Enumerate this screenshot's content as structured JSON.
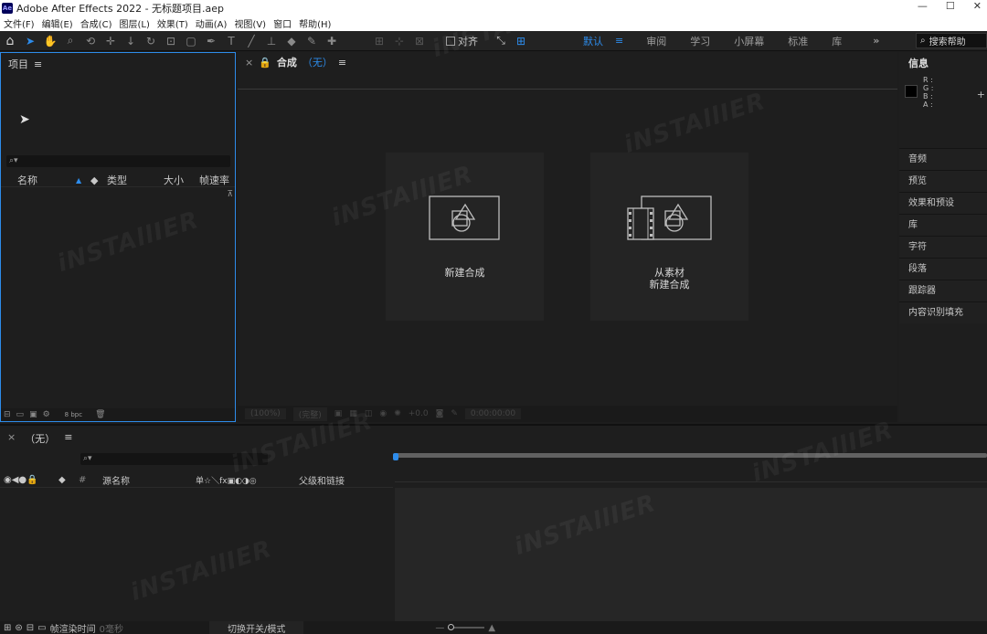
{
  "window": {
    "title": "Adobe After Effects 2022 - 无标题项目.aep",
    "logo": "Ae",
    "controls": [
      "—",
      "☐",
      "✕"
    ]
  },
  "menu": [
    "文件(F)",
    "编辑(E)",
    "合成(C)",
    "图层(L)",
    "效果(T)",
    "动画(A)",
    "视图(V)",
    "窗口",
    "帮助(H)"
  ],
  "toolbar": {
    "align_label": "对齐",
    "workspaces": [
      "默认",
      "审阅",
      "学习",
      "小屏幕",
      "标准",
      "库"
    ],
    "active_workspace": "默认",
    "overflow": "»",
    "search_help": "搜索帮助"
  },
  "project": {
    "title": "项目",
    "columns": {
      "name": "名称",
      "type": "类型",
      "size": "大小",
      "fps": "帧速率"
    },
    "bpc": "8 bpc"
  },
  "comp": {
    "tab_label": "合成",
    "tab_value": "（无）",
    "new_comp": "新建合成",
    "from_footage_l1": "从素材",
    "from_footage_l2": "新建合成",
    "zoom": "(100%)",
    "quality": "(完整)",
    "exposure": "+0.0",
    "timecode": "0:00:00:00"
  },
  "right_panel": {
    "info_title": "信息",
    "rgba": [
      "R :",
      "G :",
      "B :",
      "A :"
    ],
    "items": [
      "音频",
      "预览",
      "效果和预设",
      "库",
      "字符",
      "段落",
      "跟踪器",
      "内容识别填充"
    ]
  },
  "timeline": {
    "tab_label": "（无）",
    "columns": {
      "source": "源名称",
      "switches": "单☆＼fx▣◐◑◎",
      "parent": "父级和链接"
    },
    "footer": {
      "render_time_label": "帧渲染时间",
      "render_time_value": "0毫秒",
      "toggle_label": "切换开关/模式"
    }
  },
  "watermark": "iNSTAllIER"
}
